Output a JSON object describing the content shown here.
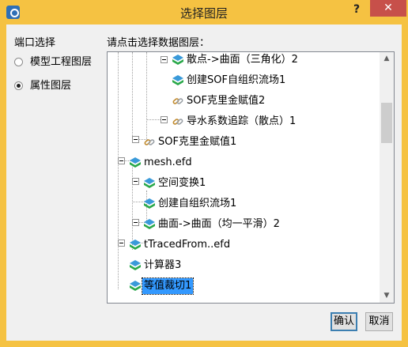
{
  "window": {
    "title": "选择图层",
    "help_label": "?",
    "close_label": "✕"
  },
  "left": {
    "title": "端口选择",
    "options": [
      {
        "label": "模型工程图层",
        "checked": false
      },
      {
        "label": "属性图层",
        "checked": true
      }
    ]
  },
  "prompt": "请点击选择数据图层：",
  "tree": {
    "rows": [
      {
        "label": "散点->曲面（三角化）2",
        "icon": "layer-stack-icon"
      },
      {
        "label": "创建SOF自组织流场1",
        "icon": "layer-stack-icon"
      },
      {
        "label": "SOF克里金赋值2",
        "icon": "link-icon"
      },
      {
        "label": "导水系数追踪（散点）1",
        "icon": "link-icon"
      },
      {
        "label": "SOF克里金赋值1",
        "icon": "link-icon"
      },
      {
        "label": "mesh.efd",
        "icon": "layer-stack-icon"
      },
      {
        "label": "空间变换1",
        "icon": "layer-stack-icon"
      },
      {
        "label": "创建自组织流场1",
        "icon": "layer-stack-icon"
      },
      {
        "label": "曲面->曲面（均一平滑）2",
        "icon": "layer-stack-icon"
      },
      {
        "label": "tTracedFrom..efd",
        "icon": "layer-stack-icon"
      },
      {
        "label": "计算器3",
        "icon": "layer-stack-icon"
      },
      {
        "label": "等值裁切1",
        "icon": "layer-stack-icon",
        "selected": true
      }
    ]
  },
  "scrollbar": {
    "up": "▲",
    "down": "▼"
  },
  "buttons": {
    "ok": "确认",
    "cancel": "取消"
  }
}
